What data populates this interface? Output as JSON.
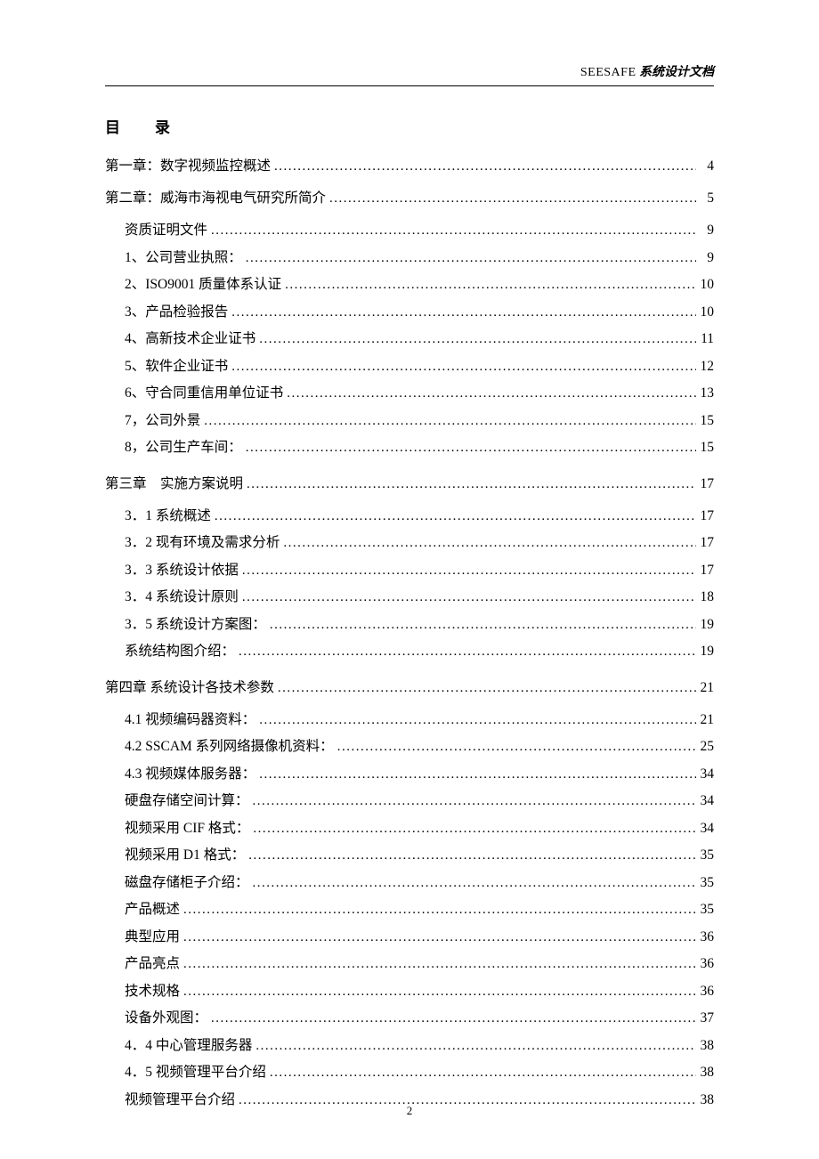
{
  "header": {
    "brand": "SEESAFE",
    "tail": " 系统设计文档"
  },
  "toc_title_a": "目",
  "toc_title_b": "录",
  "toc": [
    {
      "lvl": 1,
      "label": "第一章：数字视频监控概述",
      "page": "4"
    },
    {
      "lvl": 1,
      "label": "第二章：威海市海视电气研究所简介",
      "page": "5"
    },
    {
      "lvl": 2,
      "label": "资质证明文件",
      "page": "9"
    },
    {
      "lvl": 2,
      "label": "1、公司营业执照：",
      "page": "9"
    },
    {
      "lvl": 2,
      "label": "2、ISO9001 质量体系认证",
      "page": "10"
    },
    {
      "lvl": 2,
      "label": "3、产品检验报告",
      "page": "10"
    },
    {
      "lvl": 2,
      "label": "4、高新技术企业证书",
      "page": "11"
    },
    {
      "lvl": 2,
      "label": "5、软件企业证书",
      "page": "12"
    },
    {
      "lvl": 2,
      "label": "6、守合同重信用单位证书",
      "page": "13"
    },
    {
      "lvl": 2,
      "label": "7，公司外景",
      "page": "15"
    },
    {
      "lvl": 2,
      "label": "8，公司生产车间：",
      "page": "15"
    },
    {
      "lvl": 1,
      "label": "第三章　实施方案说明",
      "page": "17"
    },
    {
      "lvl": 2,
      "label": "3．1 系统概述",
      "page": "17"
    },
    {
      "lvl": 2,
      "label": "3．2 现有环境及需求分析",
      "page": "17"
    },
    {
      "lvl": 2,
      "label": "3．3 系统设计依据",
      "page": "17"
    },
    {
      "lvl": 2,
      "label": "3．4 系统设计原则",
      "page": "18"
    },
    {
      "lvl": 2,
      "label": "3．5 系统设计方案图：",
      "page": "19"
    },
    {
      "lvl": 2,
      "label": "系统结构图介绍：",
      "page": "19"
    },
    {
      "lvl": 1,
      "label": "第四章 系统设计各技术参数",
      "page": "21"
    },
    {
      "lvl": 2,
      "label": "4.1 视频编码器资料：",
      "page": "21"
    },
    {
      "lvl": 2,
      "label": "4.2 SSCAM 系列网络摄像机资料：",
      "page": "25"
    },
    {
      "lvl": 2,
      "label": "4.3 视频媒体服务器：",
      "page": "34"
    },
    {
      "lvl": 2,
      "label": "硬盘存储空间计算：",
      "page": "34"
    },
    {
      "lvl": 2,
      "label": "视频采用 CIF 格式：",
      "page": "34"
    },
    {
      "lvl": 2,
      "label": "视频采用 D1 格式：",
      "page": "35"
    },
    {
      "lvl": 2,
      "label": "磁盘存储柜子介绍：",
      "page": "35"
    },
    {
      "lvl": 2,
      "label": "产品概述",
      "page": "35"
    },
    {
      "lvl": 2,
      "label": "典型应用",
      "page": "36"
    },
    {
      "lvl": 2,
      "label": "产品亮点",
      "page": "36"
    },
    {
      "lvl": 2,
      "label": "技术规格",
      "page": "36"
    },
    {
      "lvl": 2,
      "label": "设备外观图：",
      "page": "37"
    },
    {
      "lvl": 2,
      "label": "4．4 中心管理服务器",
      "page": "38"
    },
    {
      "lvl": 2,
      "label": "4．5 视频管理平台介绍",
      "page": "38"
    },
    {
      "lvl": 2,
      "label": "视频管理平台介绍",
      "page": "38"
    }
  ],
  "page_number": "2"
}
